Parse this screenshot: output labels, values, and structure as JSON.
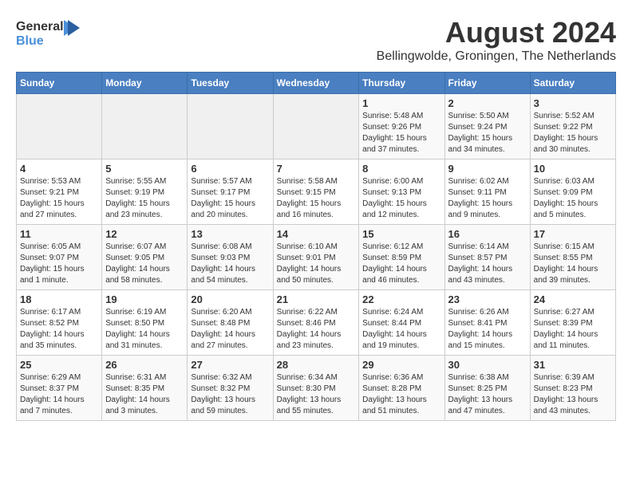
{
  "header": {
    "logo_general": "General",
    "logo_blue": "Blue",
    "month_year": "August 2024",
    "location": "Bellingwolde, Groningen, The Netherlands"
  },
  "weekdays": [
    "Sunday",
    "Monday",
    "Tuesday",
    "Wednesday",
    "Thursday",
    "Friday",
    "Saturday"
  ],
  "weeks": [
    [
      {
        "day": "",
        "empty": true
      },
      {
        "day": "",
        "empty": true
      },
      {
        "day": "",
        "empty": true
      },
      {
        "day": "",
        "empty": true
      },
      {
        "day": "1",
        "sunrise": "5:48 AM",
        "sunset": "9:26 PM",
        "daylight": "15 hours and 37 minutes."
      },
      {
        "day": "2",
        "sunrise": "5:50 AM",
        "sunset": "9:24 PM",
        "daylight": "15 hours and 34 minutes."
      },
      {
        "day": "3",
        "sunrise": "5:52 AM",
        "sunset": "9:22 PM",
        "daylight": "15 hours and 30 minutes."
      }
    ],
    [
      {
        "day": "4",
        "sunrise": "5:53 AM",
        "sunset": "9:21 PM",
        "daylight": "15 hours and 27 minutes."
      },
      {
        "day": "5",
        "sunrise": "5:55 AM",
        "sunset": "9:19 PM",
        "daylight": "15 hours and 23 minutes."
      },
      {
        "day": "6",
        "sunrise": "5:57 AM",
        "sunset": "9:17 PM",
        "daylight": "15 hours and 20 minutes."
      },
      {
        "day": "7",
        "sunrise": "5:58 AM",
        "sunset": "9:15 PM",
        "daylight": "15 hours and 16 minutes."
      },
      {
        "day": "8",
        "sunrise": "6:00 AM",
        "sunset": "9:13 PM",
        "daylight": "15 hours and 12 minutes."
      },
      {
        "day": "9",
        "sunrise": "6:02 AM",
        "sunset": "9:11 PM",
        "daylight": "15 hours and 9 minutes."
      },
      {
        "day": "10",
        "sunrise": "6:03 AM",
        "sunset": "9:09 PM",
        "daylight": "15 hours and 5 minutes."
      }
    ],
    [
      {
        "day": "11",
        "sunrise": "6:05 AM",
        "sunset": "9:07 PM",
        "daylight": "15 hours and 1 minute."
      },
      {
        "day": "12",
        "sunrise": "6:07 AM",
        "sunset": "9:05 PM",
        "daylight": "14 hours and 58 minutes."
      },
      {
        "day": "13",
        "sunrise": "6:08 AM",
        "sunset": "9:03 PM",
        "daylight": "14 hours and 54 minutes."
      },
      {
        "day": "14",
        "sunrise": "6:10 AM",
        "sunset": "9:01 PM",
        "daylight": "14 hours and 50 minutes."
      },
      {
        "day": "15",
        "sunrise": "6:12 AM",
        "sunset": "8:59 PM",
        "daylight": "14 hours and 46 minutes."
      },
      {
        "day": "16",
        "sunrise": "6:14 AM",
        "sunset": "8:57 PM",
        "daylight": "14 hours and 43 minutes."
      },
      {
        "day": "17",
        "sunrise": "6:15 AM",
        "sunset": "8:55 PM",
        "daylight": "14 hours and 39 minutes."
      }
    ],
    [
      {
        "day": "18",
        "sunrise": "6:17 AM",
        "sunset": "8:52 PM",
        "daylight": "14 hours and 35 minutes."
      },
      {
        "day": "19",
        "sunrise": "6:19 AM",
        "sunset": "8:50 PM",
        "daylight": "14 hours and 31 minutes."
      },
      {
        "day": "20",
        "sunrise": "6:20 AM",
        "sunset": "8:48 PM",
        "daylight": "14 hours and 27 minutes."
      },
      {
        "day": "21",
        "sunrise": "6:22 AM",
        "sunset": "8:46 PM",
        "daylight": "14 hours and 23 minutes."
      },
      {
        "day": "22",
        "sunrise": "6:24 AM",
        "sunset": "8:44 PM",
        "daylight": "14 hours and 19 minutes."
      },
      {
        "day": "23",
        "sunrise": "6:26 AM",
        "sunset": "8:41 PM",
        "daylight": "14 hours and 15 minutes."
      },
      {
        "day": "24",
        "sunrise": "6:27 AM",
        "sunset": "8:39 PM",
        "daylight": "14 hours and 11 minutes."
      }
    ],
    [
      {
        "day": "25",
        "sunrise": "6:29 AM",
        "sunset": "8:37 PM",
        "daylight": "14 hours and 7 minutes."
      },
      {
        "day": "26",
        "sunrise": "6:31 AM",
        "sunset": "8:35 PM",
        "daylight": "14 hours and 3 minutes."
      },
      {
        "day": "27",
        "sunrise": "6:32 AM",
        "sunset": "8:32 PM",
        "daylight": "13 hours and 59 minutes."
      },
      {
        "day": "28",
        "sunrise": "6:34 AM",
        "sunset": "8:30 PM",
        "daylight": "13 hours and 55 minutes."
      },
      {
        "day": "29",
        "sunrise": "6:36 AM",
        "sunset": "8:28 PM",
        "daylight": "13 hours and 51 minutes."
      },
      {
        "day": "30",
        "sunrise": "6:38 AM",
        "sunset": "8:25 PM",
        "daylight": "13 hours and 47 minutes."
      },
      {
        "day": "31",
        "sunrise": "6:39 AM",
        "sunset": "8:23 PM",
        "daylight": "13 hours and 43 minutes."
      }
    ]
  ]
}
